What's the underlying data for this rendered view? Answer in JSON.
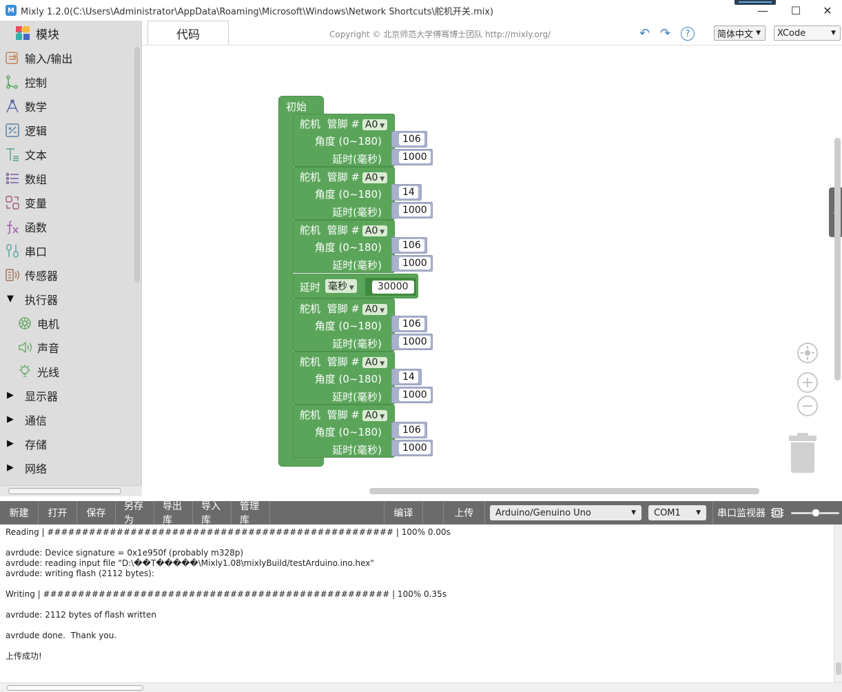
{
  "window": {
    "title": "Mixly 1.2.0(C:\\Users\\Administrator\\AppData\\Roaming\\Microsoft\\Windows\\Network Shortcuts\\舵机开关.mix)",
    "icon_text": "M",
    "minimize": "—",
    "maximize": "☐",
    "close": "✕"
  },
  "sidebar": {
    "header": "模块",
    "items": [
      {
        "label": "输入/输出",
        "icon": "io-icon"
      },
      {
        "label": "控制",
        "icon": "control-icon"
      },
      {
        "label": "数学",
        "icon": "math-icon"
      },
      {
        "label": "逻辑",
        "icon": "logic-icon"
      },
      {
        "label": "文本",
        "icon": "text-icon"
      },
      {
        "label": "数组",
        "icon": "list-icon"
      },
      {
        "label": "变量",
        "icon": "variable-icon"
      },
      {
        "label": "函数",
        "icon": "function-icon"
      },
      {
        "label": "串口",
        "icon": "serial-icon"
      },
      {
        "label": "传感器",
        "icon": "sensor-icon"
      }
    ],
    "actuator": {
      "label": "执行器",
      "expanded": true
    },
    "actuator_children": [
      {
        "label": "电机",
        "icon": "motor-icon"
      },
      {
        "label": "声音",
        "icon": "sound-icon"
      },
      {
        "label": "光线",
        "icon": "light-icon"
      }
    ],
    "collapsed": [
      {
        "label": "显示器"
      },
      {
        "label": "通信"
      },
      {
        "label": "存储"
      },
      {
        "label": "网络"
      }
    ]
  },
  "header": {
    "code_tab": "代码",
    "copyright": "Copyright © 北京师范大学傅骞博士团队 http://mixly.org/",
    "language": "简体中文",
    "theme": "XCode"
  },
  "blocks": {
    "setup_label": "初始化",
    "servo_label": "舵机",
    "pin_label": "管脚 #",
    "pin_value": "A0",
    "angle_label": "角度 (0~180)",
    "delay_ms_label": "延时(毫秒)",
    "servos_1": [
      {
        "angle": "106",
        "delay": "1000"
      },
      {
        "angle": "14",
        "delay": "1000"
      },
      {
        "angle": "106",
        "delay": "1000"
      }
    ],
    "delay_block": {
      "label": "延时",
      "unit": "毫秒",
      "value": "30000"
    },
    "servos_2": [
      {
        "angle": "106",
        "delay": "1000"
      },
      {
        "angle": "14",
        "delay": "1000"
      },
      {
        "angle": "106",
        "delay": "1000"
      }
    ]
  },
  "toolbar": {
    "new": "新建",
    "open": "打开",
    "save": "保存",
    "save_as": "另存为",
    "export_lib": "导出库",
    "import_lib": "导入库",
    "manage_lib": "管理库",
    "compile": "编译",
    "upload": "上传",
    "board": "Arduino/Genuino Uno",
    "port": "COM1",
    "serial_monitor": "串口监视器"
  },
  "console": {
    "lines": [
      "Reading | ################################################## | 100% 0.00s",
      "",
      "avrdude: Device signature = 0x1e950f (probably m328p)",
      "avrdude: reading input file \"D:\\��T�����\\Mixly1.08\\mixlyBuild/testArduino.ino.hex\"",
      "avrdude: writing flash (2112 bytes):",
      "",
      "Writing | ################################################## | 100% 0.35s",
      "",
      "avrdude: 2112 bytes of flash written",
      "",
      "avrdude done.  Thank you.",
      "",
      "上传成功!"
    ]
  }
}
